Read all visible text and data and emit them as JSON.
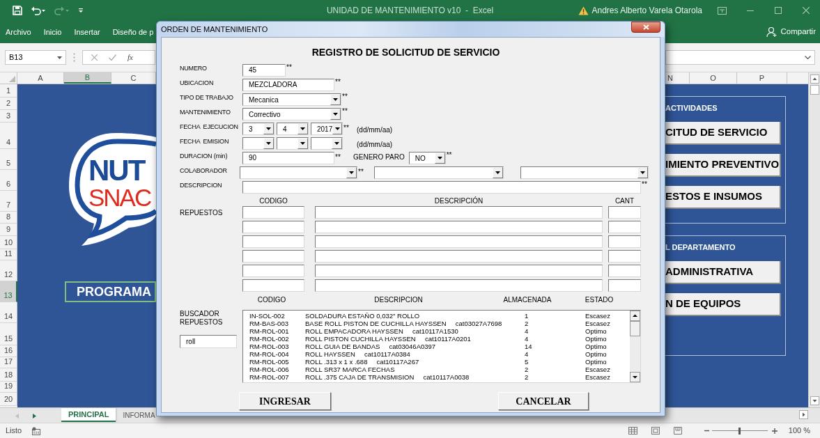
{
  "excel": {
    "title": "UNIDAD DE MANTENIMIENTO v10  -  Excel",
    "user": "Andres Alberto Varela Otarola",
    "ribbon_tabs": [
      "Archivo",
      "Inicio",
      "Insertar",
      "Diseño de p"
    ],
    "share": "Compartir",
    "name_box": "B13",
    "function_label": "fx",
    "columns_left": [
      {
        "label": "A",
        "selected": false
      },
      {
        "label": "B",
        "selected": true
      },
      {
        "label": "C",
        "selected": false
      }
    ],
    "columns_right": [
      {
        "label": "N",
        "selected": false
      },
      {
        "label": "O",
        "selected": false
      },
      {
        "label": "P",
        "selected": false
      }
    ],
    "rows": [
      {
        "label": "1",
        "selected": false
      },
      {
        "label": "2",
        "selected": false
      },
      {
        "label": "3",
        "selected": false
      },
      {
        "label": "4",
        "selected": false
      },
      {
        "label": "5",
        "selected": false
      },
      {
        "label": "6",
        "selected": false
      },
      {
        "label": "7",
        "selected": false
      },
      {
        "label": "8",
        "selected": false
      },
      {
        "label": "9",
        "selected": false
      },
      {
        "label": "10",
        "selected": false
      },
      {
        "label": "11",
        "selected": false
      },
      {
        "label": "12",
        "selected": false
      },
      {
        "label": "13",
        "selected": true
      },
      {
        "label": "14",
        "selected": false
      },
      {
        "label": "15",
        "selected": false
      },
      {
        "label": "16",
        "selected": false
      },
      {
        "label": "17",
        "selected": false
      },
      {
        "label": "18",
        "selected": false
      },
      {
        "label": "19",
        "selected": false
      },
      {
        "label": "20",
        "selected": false
      }
    ],
    "sheet": {
      "logo": [
        "NUT",
        "SNAC"
      ],
      "program_button": "PROGRAMA",
      "sections": [
        {
          "title": "ACTIVIDADES",
          "buttons": [
            "CITUD DE SERVICIO",
            "IMIENTO PREVENTIVO",
            "ESTOS E INSUMOS"
          ]
        },
        {
          "title": "L DEPARTAMENTO",
          "buttons": [
            "ADMINISTRATIVA",
            "N DE EQUIPOS"
          ]
        }
      ]
    },
    "sheet_tabs": [
      {
        "label": "PRINCIPAL",
        "selected": true
      },
      {
        "label": "INFORMA",
        "selected": false
      }
    ],
    "status_bar": {
      "text": "Listo",
      "zoom": "100 %",
      "zoom_slider": {
        "level": 0.5
      }
    }
  },
  "dialog": {
    "title": "ORDEN DE MANTENIMIENTO",
    "heading": "REGISTRO DE SOLICITUD DE SERVICIO",
    "fields": [
      {
        "kind": "number",
        "label": "NUMERO",
        "value": "45",
        "mark": "**"
      },
      {
        "kind": "text",
        "label": "UBICACION",
        "value": "MEZCLADORA",
        "mark": "**"
      },
      {
        "kind": "combo",
        "label": "TIPO DE TRABAJO",
        "value": "Mecanica",
        "mark": "**"
      },
      {
        "kind": "combo",
        "label": "MANTENIMIENTO",
        "value": "Correctivo",
        "mark": "**"
      },
      {
        "kind": "date",
        "label": "FECHA  EJECUCION",
        "parts": [
          {
            "kind": "combo",
            "value": "3"
          },
          {
            "kind": "combo",
            "value": "4"
          },
          {
            "kind": "combo",
            "value": "2017"
          }
        ],
        "mark": "**",
        "hint": "(dd/mm/aa)"
      },
      {
        "kind": "date",
        "label": "FECHA  EMISION",
        "parts": [
          {
            "kind": "combo"
          },
          {
            "kind": "combo"
          },
          {
            "kind": "combo"
          }
        ],
        "hint": "(dd/mm/aa)"
      },
      {
        "kind": "duration",
        "label": "DURACION (min)",
        "value": "90",
        "mark": "**",
        "extra": {
          "label": "GENERO PARO",
          "value": "NO",
          "mark": "**"
        }
      },
      {
        "kind": "multi_combo",
        "label": "COLABORADOR",
        "combos": [
          {
            "kind": "combo",
            "mark": "**"
          },
          {
            "kind": "combo"
          },
          {
            "kind": "combo"
          }
        ]
      },
      {
        "kind": "wide_text",
        "label": "DESCRIPCION",
        "mark": "**"
      }
    ],
    "parts_table": {
      "label": "REPUESTOS",
      "columns": [
        "CODIGO",
        "DESCRIPCIÓN",
        "CANT"
      ],
      "rows": [
        {
          "kind": "blank"
        },
        {
          "kind": "blank"
        },
        {
          "kind": "blank"
        },
        {
          "kind": "blank"
        },
        {
          "kind": "blank"
        },
        {
          "kind": "blank"
        }
      ]
    },
    "search": {
      "label": "BUSCADOR REPUESTOS",
      "value": "roll",
      "columns": [
        "CODIGO",
        "DESCRIPCION",
        "ALMACENADA",
        "ESTADO"
      ],
      "results": [
        {
          "code": "IN-SOL-002",
          "description": "SOLDADURA ESTAÑO 0,032\" ROLLO",
          "stock": "1",
          "status": "Escasez"
        },
        {
          "code": "RM-BAS-003",
          "description": "BASE ROLL PISTON DE CUCHILLA HAYSSEN     cat03027A7698",
          "stock": "2",
          "status": "Escasez"
        },
        {
          "code": "RM-ROL-001",
          "description": "ROLL EMPACADORA HAYSSEN     cat10117A1530",
          "stock": "4",
          "status": "Optimo"
        },
        {
          "code": "RM-ROL-002",
          "description": "ROLL PISTON CUCHILLA HAYSSEN     cat10117A0201",
          "stock": "4",
          "status": "Optimo"
        },
        {
          "code": "RM-ROL-003",
          "description": "ROLL GUIA DE BANDAS     cat03046A0397",
          "stock": "14",
          "status": "Optimo"
        },
        {
          "code": "RM-ROL-004",
          "description": "ROLL HAYSSEN     cat10117A0384",
          "stock": "4",
          "status": "Optimo"
        },
        {
          "code": "RM-ROL-005",
          "description": "ROLL .313 x 1 x .688     cat10117A267",
          "stock": "5",
          "status": "Optimo"
        },
        {
          "code": "RM-ROL-006",
          "description": "ROLL SR37 MARCA FECHAS",
          "stock": "2",
          "status": "Escasez"
        },
        {
          "code": "RM-ROL-007",
          "description": "ROLL .375 CAJA DE TRANSMISION     cat10117A0038",
          "stock": "2",
          "status": "Escasez"
        }
      ]
    },
    "buttons": [
      "INGRESAR",
      "CANCELAR"
    ]
  }
}
